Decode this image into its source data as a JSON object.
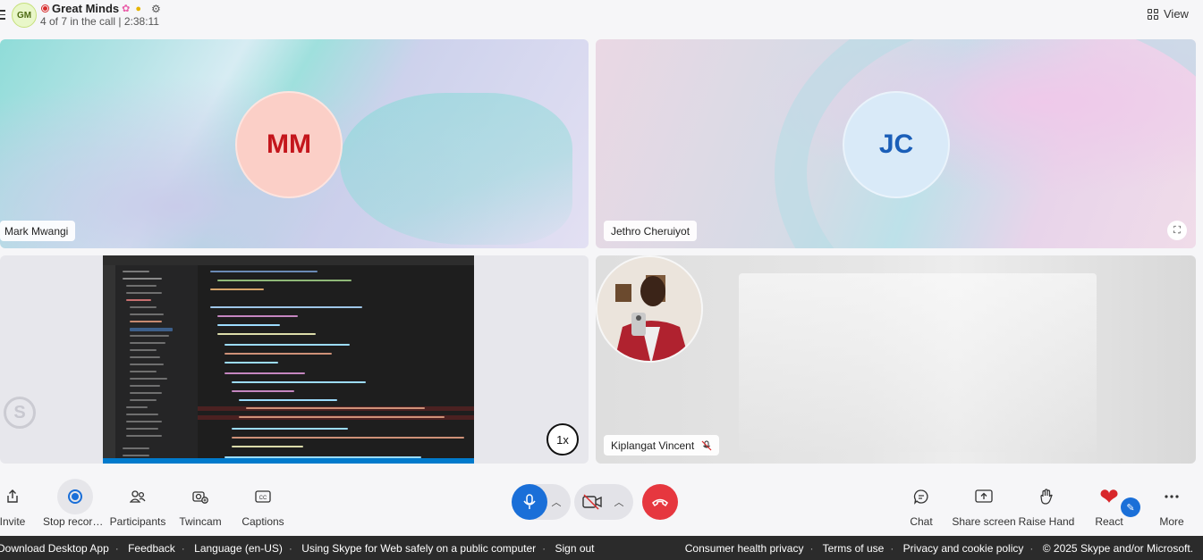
{
  "header": {
    "avatar_initials": "GM",
    "title": "Great Minds",
    "subtitle": "4 of 7 in the call | 2:38:11",
    "view_label": "View"
  },
  "tiles": {
    "mark": {
      "initials": "MM",
      "name": "Mark Mwangi"
    },
    "jethro": {
      "initials": "JC",
      "name": "Jethro Cheruiyot"
    },
    "screen_share": {
      "speed_label": "1x",
      "watermark": "S"
    },
    "kiplangat": {
      "name": "Kiplangat Vincent",
      "mic_status": "muted"
    }
  },
  "toolbar": {
    "left": [
      {
        "label": "Invite",
        "icon": "share-icon"
      },
      {
        "label": "Stop recording",
        "icon": "record-icon",
        "active": true
      },
      {
        "label": "Participants",
        "icon": "participants-icon"
      },
      {
        "label": "Twincam",
        "icon": "twincam-icon"
      },
      {
        "label": "Captions",
        "icon": "captions-icon"
      }
    ],
    "right": [
      {
        "label": "Chat",
        "icon": "chat-icon"
      },
      {
        "label": "Share screen",
        "icon": "share-screen-icon"
      },
      {
        "label": "Raise Hand",
        "icon": "hand-icon"
      },
      {
        "label": "React",
        "icon": "heart-icon"
      },
      {
        "label": "More",
        "icon": "more-icon"
      }
    ]
  },
  "footer": {
    "left": [
      "Download Desktop App",
      "Feedback",
      "Language (en-US)",
      "Using Skype for Web safely on a public computer",
      "Sign out"
    ],
    "right": [
      "Consumer health privacy",
      "Terms of use",
      "Privacy and cookie policy",
      "© 2025 Skype and/or Microsoft."
    ]
  },
  "colors": {
    "accent": "#1a6fd8",
    "end_call": "#e6373f",
    "recording": "#d92c2c"
  }
}
